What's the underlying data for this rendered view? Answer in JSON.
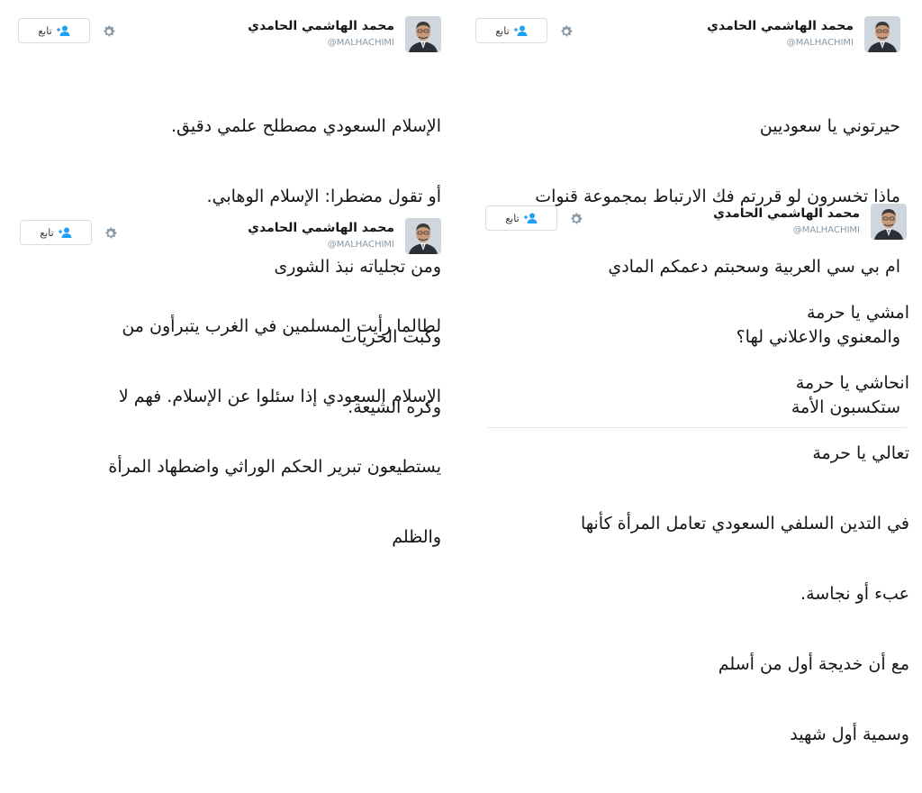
{
  "author": {
    "name": "محمد الهاشمي الحامدي",
    "handle": "@MALHACHIMI"
  },
  "follow_label": "تابع",
  "icons": {
    "settings": "gear-icon",
    "follow": "person-add-icon",
    "avatar": "profile-photo"
  },
  "colors": {
    "accent": "#1da1f2",
    "text": "#14171a",
    "muted": "#8899a6",
    "border": "#d8dfe4"
  },
  "tweets": [
    {
      "lines": [
        "حيرتوني يا سعوديين",
        "ماذا تخسرون لو قررتم فك الارتباط بمجموعة قنوات",
        "ام بي سي العربية وسحبتم دعمكم المادي",
        "والمعنوي والاعلاني لها؟",
        "ستكسبون الأمة"
      ]
    },
    {
      "lines": [
        "الإسلام السعودي مصطلح علمي دقيق.",
        "أو تقول مضطرا: الإسلام الوهابي.",
        "ومن تجلياته نبذ الشورى",
        "وكبت الحريات",
        "وكره الشيعة."
      ]
    },
    {
      "lines": [
        "امشي يا حرمة",
        "انحاشي يا حرمة",
        "تعالي يا حرمة",
        "في التدين السلفي السعودي تعامل المرأة كأنها",
        "عبء أو نجاسة.",
        "مع أن خديجة أول من أسلم",
        "وسمية أول شهيد"
      ]
    },
    {
      "lines": [
        "لطالما رأيت المسلمين في الغرب يتبرأون من",
        "الإسلام السعودي إذا سئلوا عن الإسلام. فهم لا",
        "يستطيعون تبرير الحكم الوراثي واضطهاد المرأة",
        "والظلم"
      ]
    }
  ]
}
